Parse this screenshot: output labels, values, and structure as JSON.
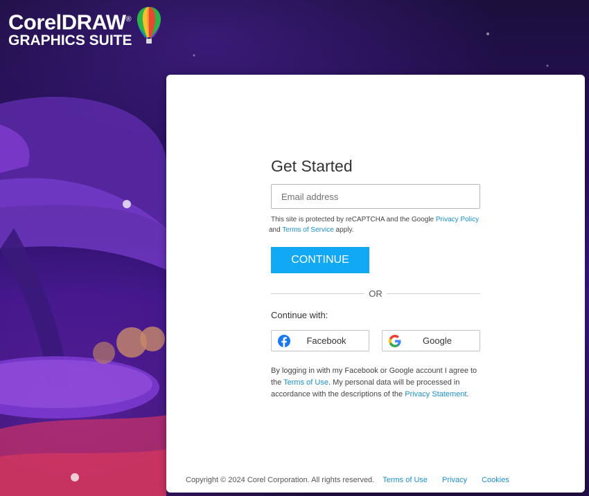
{
  "logo": {
    "line1": "CorelDRAW",
    "line2": "GRAPHICS SUITE",
    "registered": "®"
  },
  "signin": {
    "title": "Get Started",
    "email_placeholder": "Email address",
    "recaptcha_prefix": "This site is protected by reCAPTCHA and the Google ",
    "privacy_policy": "Privacy Policy",
    "recaptcha_and": " and ",
    "terms_of_service": "Terms of Service",
    "recaptcha_suffix": " apply.",
    "continue_label": "CONTINUE",
    "or_label": "OR",
    "continue_with": "Continue with:",
    "facebook_label": "Facebook",
    "google_label": "Google",
    "consent_prefix": "By logging in with my Facebook or Google account I agree to the ",
    "terms_of_use": "Terms of Use",
    "consent_middle": ". My personal data will be processed in accordance with the descriptions of the ",
    "privacy_statement": "Privacy Statement",
    "consent_suffix": "."
  },
  "footer": {
    "copyright": "Copyright © 2024 Corel Corporation. All rights reserved.",
    "links": [
      "Terms of Use",
      "Privacy",
      "Cookies"
    ]
  },
  "colors": {
    "accent": "#11a8f5",
    "link": "#1a8fd1",
    "background": "#2a1060"
  },
  "icons": [
    "balloon-logo-icon",
    "facebook-icon",
    "google-icon"
  ]
}
